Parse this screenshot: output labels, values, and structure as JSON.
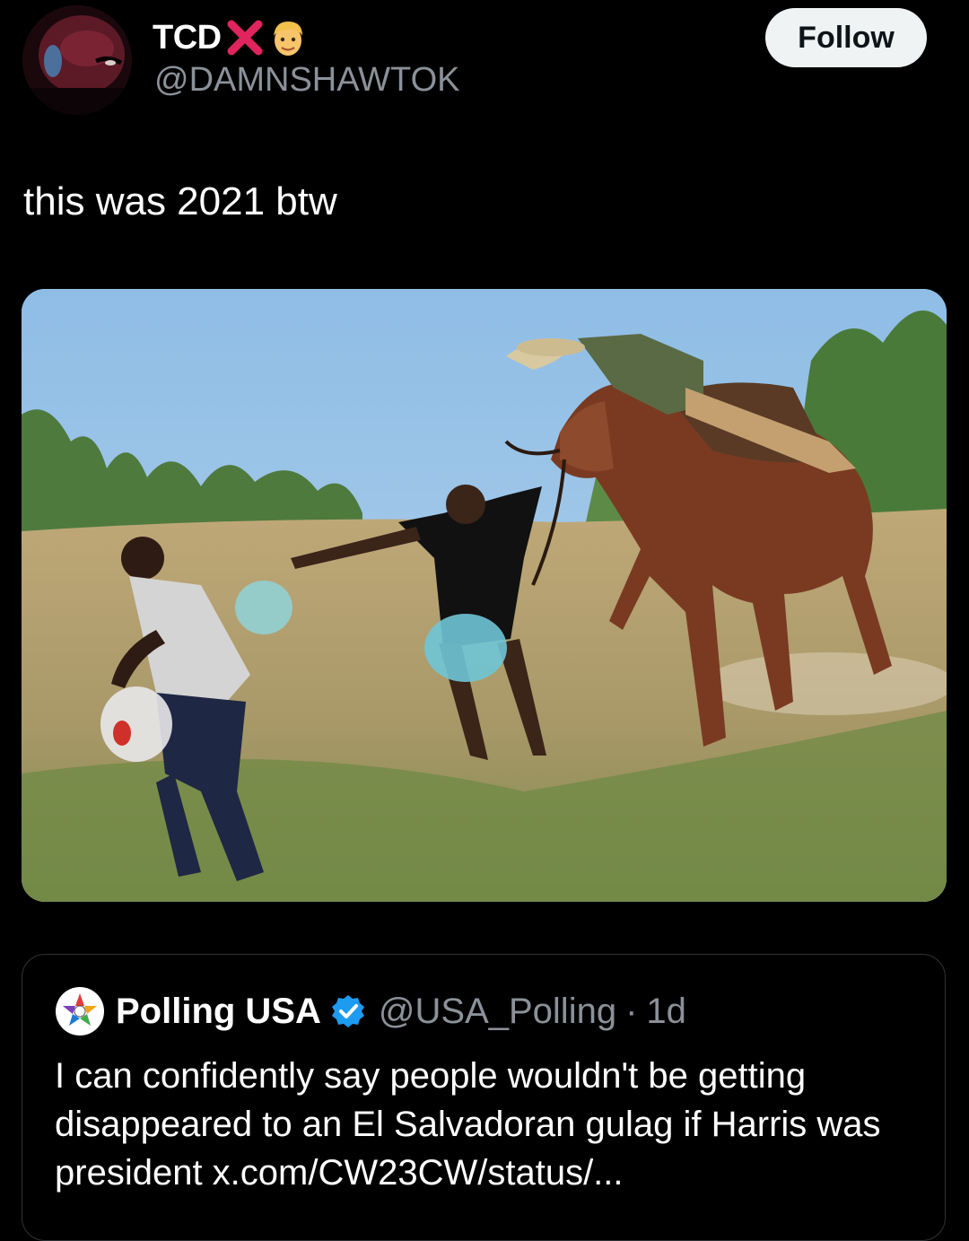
{
  "author": {
    "display_name": "TCD",
    "handle": "@DAMNSHAWTOK",
    "name_emojis": [
      "cross-mark-icon",
      "face-emoji-icon"
    ]
  },
  "follow_button": {
    "label": "Follow"
  },
  "tweet": {
    "text": "this was 2021 btw"
  },
  "media": {
    "description_icon": "photo-icon"
  },
  "quote": {
    "name": "Polling USA",
    "verified": true,
    "handle": "@USA_Polling",
    "separator": "·",
    "time": "1d",
    "text": "I can confidently say people wouldn't be getting disappeared to an El Salvadoran gulag if Harris was president x.com/CW23CW/status/..."
  },
  "colors": {
    "background": "#000000",
    "text": "#ffffff",
    "muted": "#8b9199",
    "follow_bg": "#eff3f4",
    "verified": "#1d9bf0",
    "cross": "#e0245e"
  }
}
